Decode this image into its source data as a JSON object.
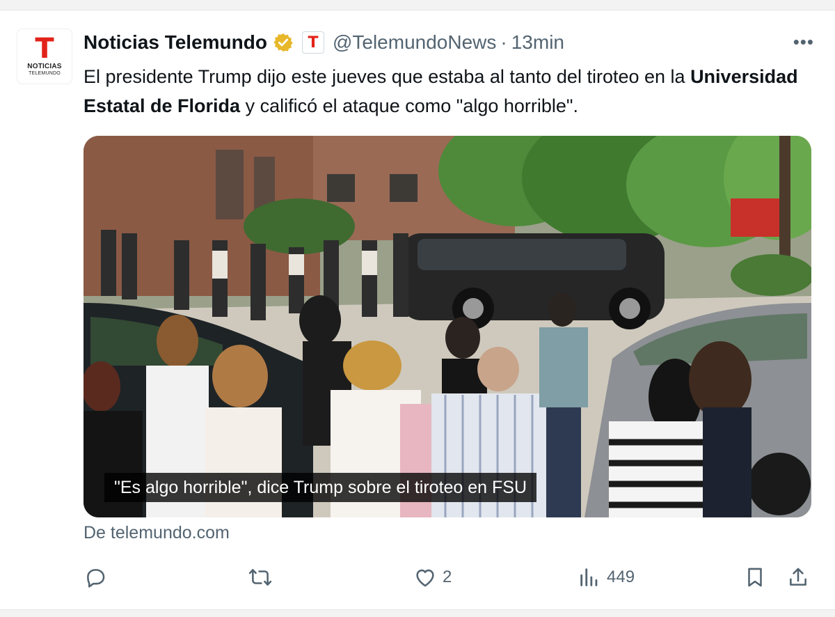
{
  "account": {
    "name": "Noticias Telemundo",
    "handle": "@TelemundoNews",
    "separator": "·",
    "time": "13min",
    "avatar_brand": "NOTICIAS",
    "avatar_brand_sub": "TELEMUNDO",
    "affiliate_glyph": "T",
    "verified_color": "#e8b82a"
  },
  "post": {
    "text_part1": "El presidente Trump dijo este jueves que estaba al tanto del tiroteo en la",
    "text_bold": "Universidad Estatal de Florida",
    "text_part2": "y calificó el ataque como \"algo horrible\"."
  },
  "media": {
    "caption": "\"Es algo horrible\", dice Trump sobre el tiroteo en FSU"
  },
  "link_source": "De telemundo.com",
  "actions": {
    "reply_icon": "reply-icon",
    "repost_icon": "repost-icon",
    "like_icon": "heart-icon",
    "like_count": "2",
    "views_icon": "views-icon",
    "views_count": "449",
    "bookmark_icon": "bookmark-icon",
    "share_icon": "share-icon"
  },
  "more_label": "•••",
  "colors": {
    "brand_red": "#e2231a",
    "muted": "#536471"
  }
}
